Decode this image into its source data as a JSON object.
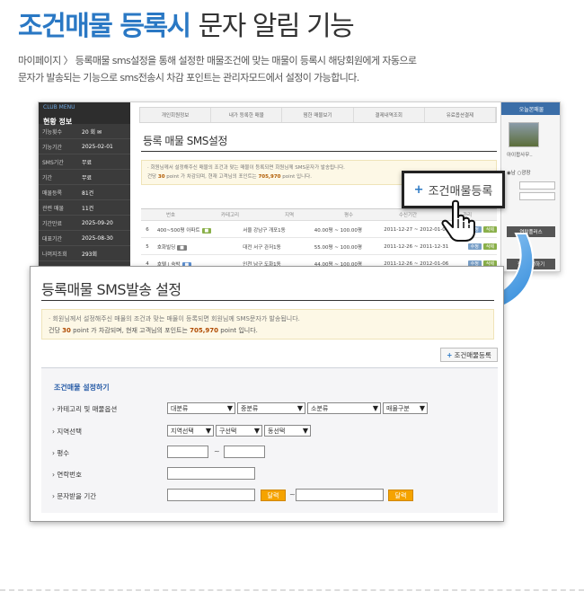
{
  "hero": {
    "title_accent": "조건매물 등록시",
    "title_rest": "문자 알림 기능",
    "desc_line1": "마이페이지 〉 등록매물 sms설정을 통해 설정한 매물조건에 맞는 매물이 등록시 해당회원에게 자동으로",
    "desc_line2": "문자가 발송되는 기능으로 sms전송시 차감 포인트는 관리자모드에서 설정이 가능합니다."
  },
  "bg_screen": {
    "side": {
      "head_sub": "CLUB MENU",
      "head_main": "현황 정보",
      "rows": [
        {
          "k": "기능횟수",
          "v": "20 회  ✉"
        },
        {
          "k": "기능기간",
          "v": "2025-02-01"
        },
        {
          "k": "SMS기간",
          "v": "무료"
        },
        {
          "k": "기간",
          "v": "무료"
        },
        {
          "k": "매물등록",
          "v": "81건"
        },
        {
          "k": "관련 매물",
          "v": "11건"
        },
        {
          "k": "기간만료",
          "v": "2025-09-20"
        },
        {
          "k": "대표기간",
          "v": "2025-08-30"
        },
        {
          "k": "나머지조회",
          "v": "293회"
        },
        {
          "k": "포인트조회",
          "v": "705,970 점"
        }
      ]
    },
    "tabs": [
      "개인회원정보",
      "내가 등록한 매물",
      "찜한 매물보기",
      "결제내역조회",
      "유료옵션결제"
    ],
    "title": "등록 매물 SMS설정",
    "notice_line1": "· 회원님께서 설정해주신 매물의 조건과 맞는 매물이 등록되면 회원님께 SMS문자가 발송됩니다.",
    "notice_pre": "건당",
    "notice_point": "30",
    "notice_mid": "point 가 차감되며, 현재 고객님의 포인트는",
    "notice_total": "705,970",
    "notice_post": "point 입니다.",
    "table_cols": [
      "번호",
      "카테고리",
      "지역",
      "평수",
      "수신기간",
      "관리"
    ],
    "rows": [
      {
        "no": "6",
        "cat": "400~500평 아파트",
        "region": "서울 강남구 개포1동",
        "area": "40.00평 ~ 100.00평",
        "period": "2011-12-27 ~ 2012-01-07"
      },
      {
        "no": "5",
        "cat": "호화빌딩",
        "region": "대전 서구 관저1동",
        "area": "55.00평 ~ 100.00평",
        "period": "2011-12-26 ~ 2011-12-31"
      },
      {
        "no": "4",
        "cat": "호텔 | 숙박",
        "region": "인천 남구 도화1동",
        "area": "44.00평 ~ 100.00평",
        "period": "2011-12-26 ~ 2012-01-06"
      }
    ],
    "chip_labels": [
      "수정",
      "삭제"
    ],
    "right": {
      "head": "오늘본매물",
      "caption": "아이팝사무..",
      "radio": "◉남 ○광장",
      "btn1": "연락플러스",
      "btn2": "정보수정하기"
    }
  },
  "callout": {
    "label": "조건매물등록",
    "plus": "+"
  },
  "dialog": {
    "title": "등록매물 SMS발송 설정",
    "notice_line1": "· 회원님께서 설정해주신 매물의 조건과 맞는 매물이 등록되면 회원님께 SMS문자가 발송됩니다.",
    "notice_pre": "건당",
    "notice_point": "30",
    "notice_mid": "point 가 차감되며, 현재 고객님의 포인트는",
    "notice_total": "705,970",
    "notice_post": "point 입니다.",
    "reg_button": "조건매물등록",
    "reg_plus": "+",
    "form": {
      "section_title": "조건매물 설정하기",
      "labels": {
        "category": "› 카테고리 및 매물옵션",
        "region": "› 지역선택",
        "area": "› 평수",
        "contact": "› 연락번호",
        "period": "› 문자받을 기간"
      },
      "category_selects": [
        "대분류",
        "중분류",
        "소분류",
        "매물구분"
      ],
      "region_selects": [
        "지역선택",
        "구선택",
        "동선택"
      ],
      "tilde": "~",
      "cal_label": "달력"
    }
  },
  "colors": {
    "accent": "#2a78c4",
    "title_dark": "#333333",
    "cal_orange": "#f5a300",
    "notice_bg": "#fdf8e6",
    "highlight": "#b04a00"
  }
}
